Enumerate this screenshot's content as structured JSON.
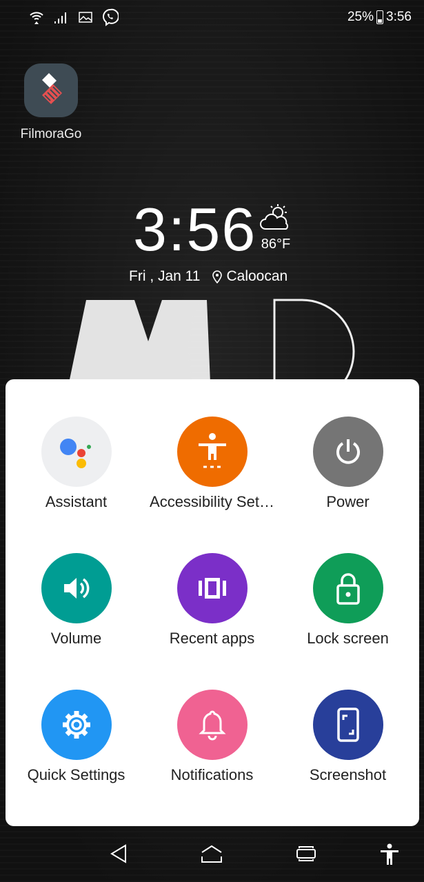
{
  "status_bar": {
    "battery": "25%",
    "time": "3:56",
    "battery_level": 0.25,
    "icons": [
      "wifi-icon",
      "signal-icon",
      "gallery-icon",
      "viber-icon"
    ]
  },
  "home": {
    "app_label": "FilmoraGo",
    "clock": "3:56",
    "temperature": "86°F",
    "date": "Fri , Jan 11",
    "location": "Caloocan"
  },
  "menu": {
    "items": [
      {
        "label": "Assistant",
        "icon": "assistant-icon",
        "color": "#eeeff1"
      },
      {
        "label": "Accessibility Set…",
        "icon": "accessibility-icon",
        "color": "#ef6c00"
      },
      {
        "label": "Power",
        "icon": "power-icon",
        "color": "#757575"
      },
      {
        "label": "Volume",
        "icon": "volume-icon",
        "color": "#009d93"
      },
      {
        "label": "Recent apps",
        "icon": "recent-apps-icon",
        "color": "#7b2fc8"
      },
      {
        "label": "Lock screen",
        "icon": "lock-icon",
        "color": "#0f9d58"
      },
      {
        "label": "Quick Settings",
        "icon": "gear-icon",
        "color": "#2196f3"
      },
      {
        "label": "Notifications",
        "icon": "bell-icon",
        "color": "#f06292"
      },
      {
        "label": "Screenshot",
        "icon": "screenshot-icon",
        "color": "#283f9a"
      }
    ]
  },
  "nav": [
    "back",
    "home",
    "recents",
    "accessibility"
  ]
}
